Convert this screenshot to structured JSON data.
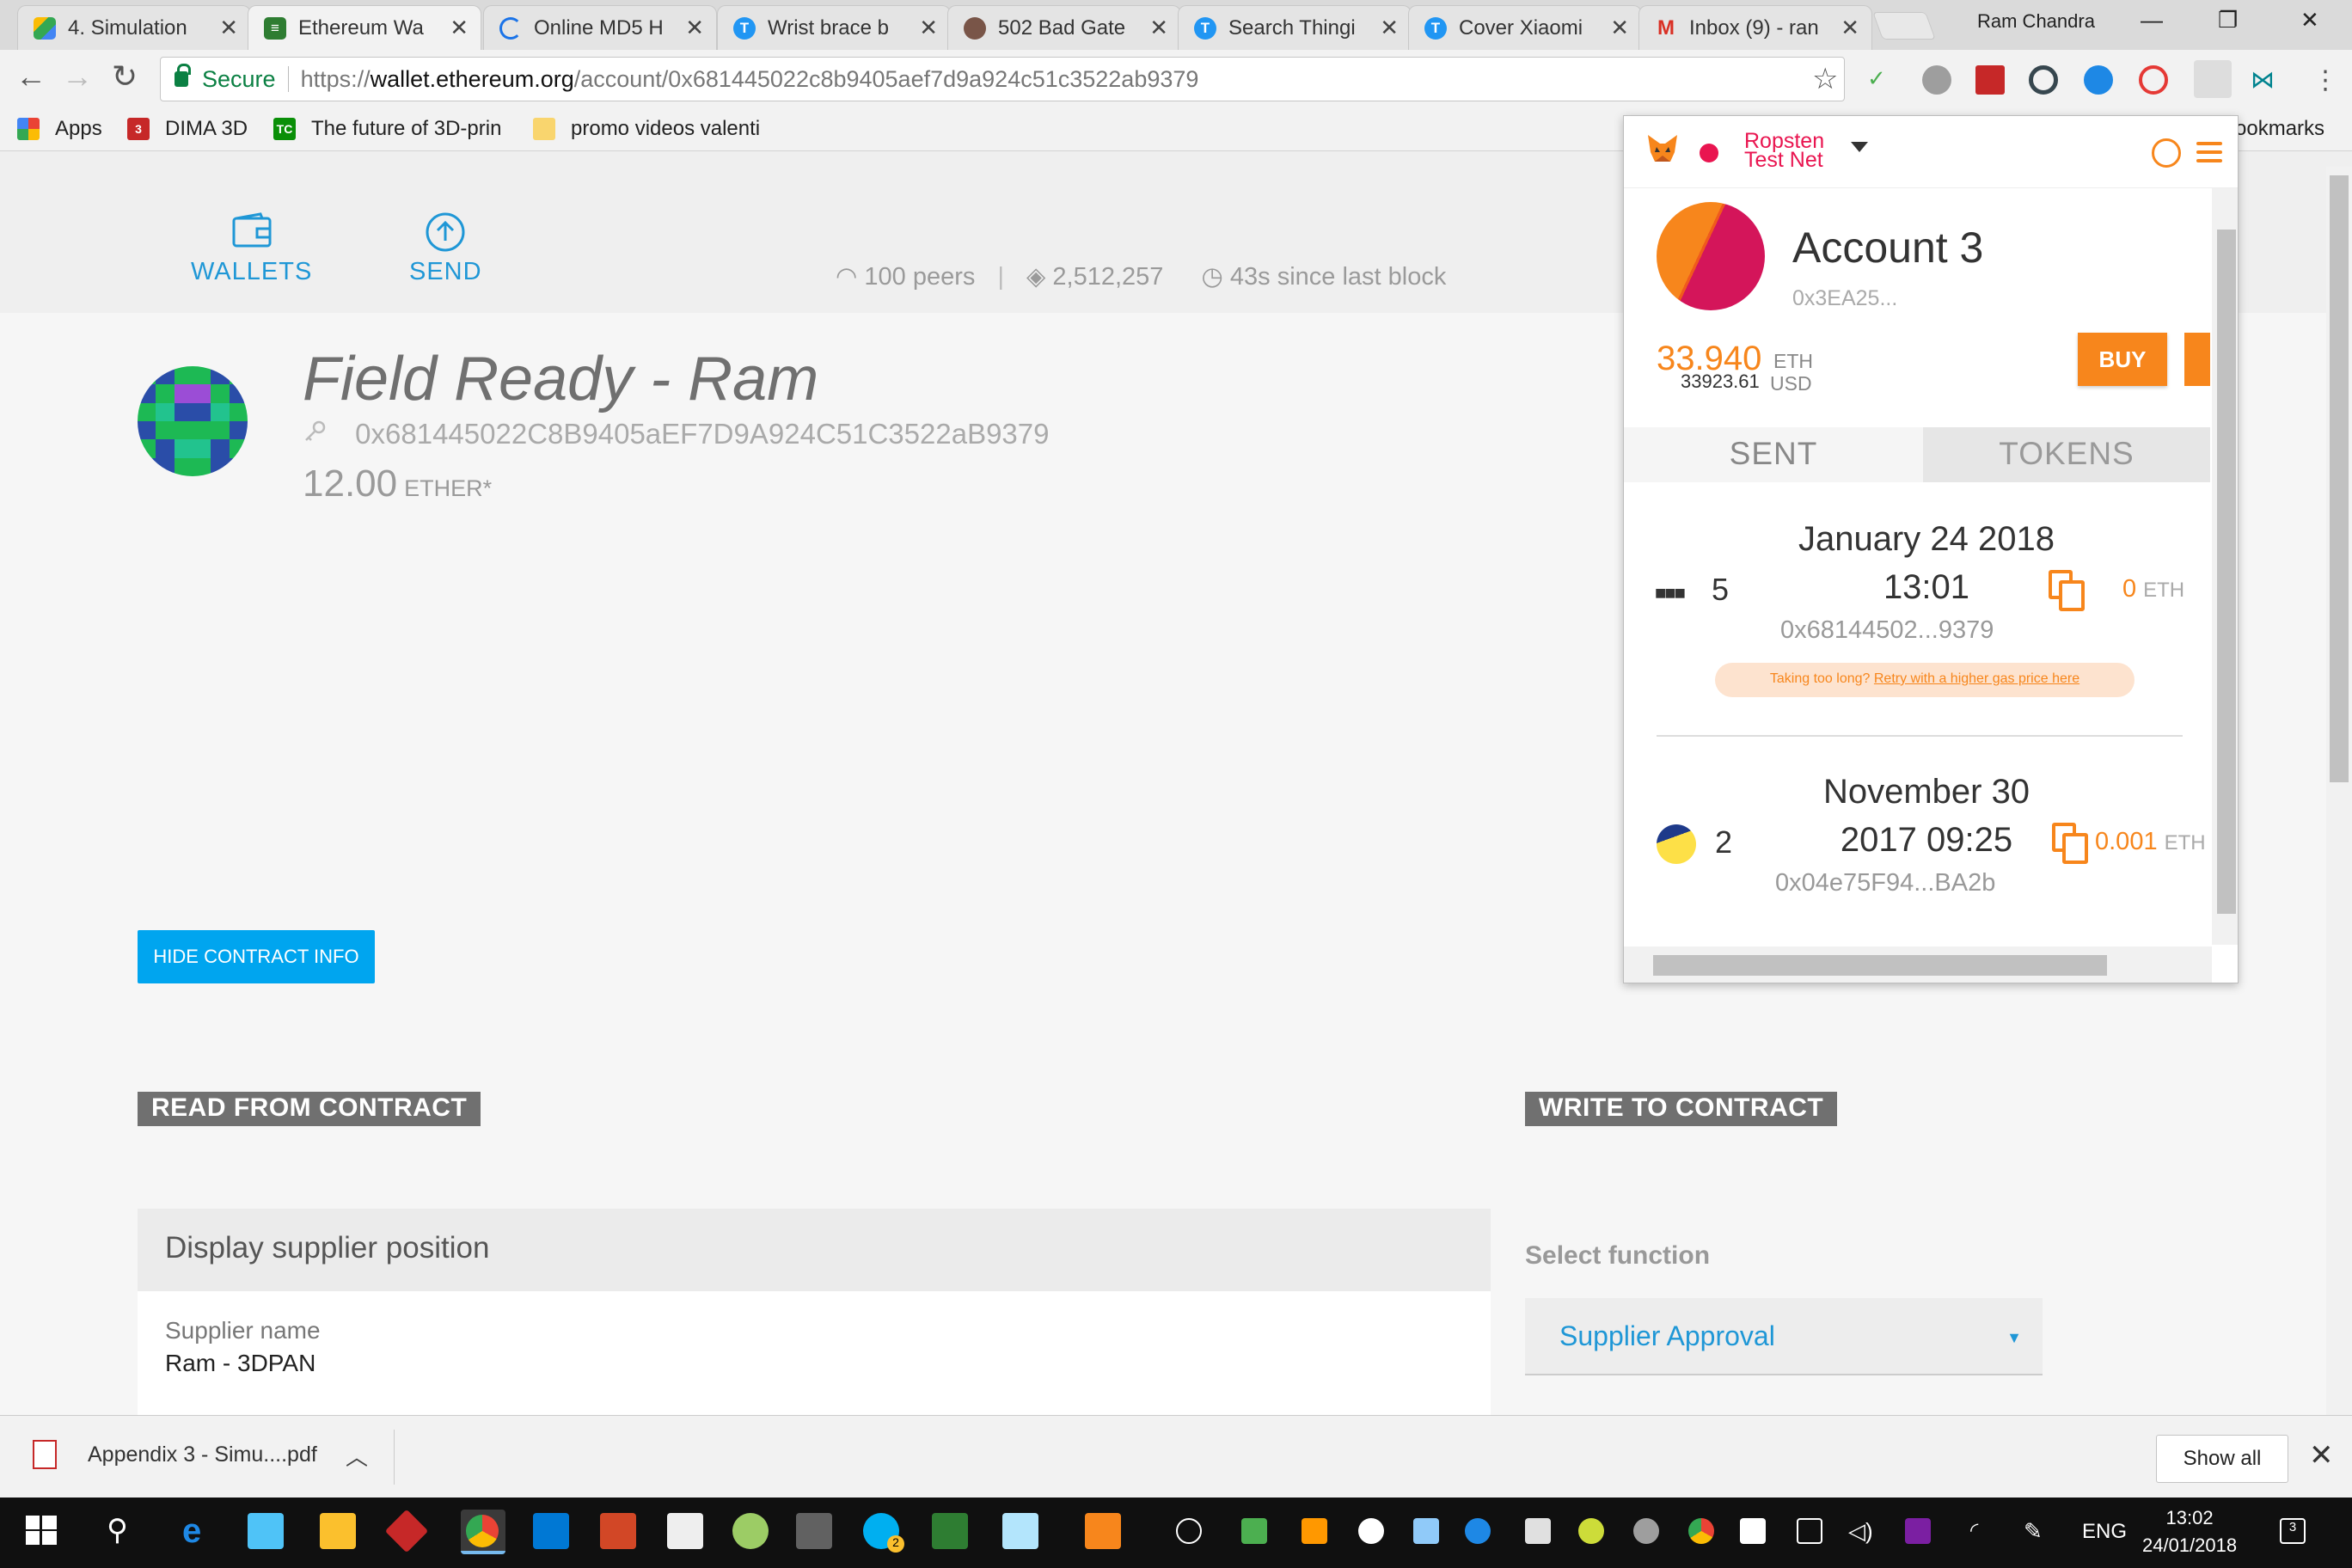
{
  "browser": {
    "tabs": [
      {
        "title": "4. Simulation",
        "icon": "google-drive-icon",
        "color": "#4c8bf5"
      },
      {
        "title": "Ethereum Wa",
        "icon": "ethereum-wallet-icon",
        "color": "#2e7d32"
      },
      {
        "title": "Online MD5 H",
        "icon": "loading-spinner-icon",
        "color": "#1a73e8"
      },
      {
        "title": "Wrist brace b",
        "icon": "tinkercad-icon",
        "color": "#2196f3"
      },
      {
        "title": "502 Bad Gate",
        "icon": "avatar-icon",
        "color": "#795548"
      },
      {
        "title": "Search Thingi",
        "icon": "tinkercad-icon",
        "color": "#2196f3"
      },
      {
        "title": "Cover Xiaomi",
        "icon": "tinkercad-icon",
        "color": "#2196f3"
      },
      {
        "title": "Inbox (9) - ran",
        "icon": "gmail-icon",
        "color": "#d93025"
      }
    ],
    "profile_name": "Ram Chandra",
    "secure_label": "Secure",
    "url_scheme": "https://",
    "url_domain": "wallet.ethereum.org",
    "url_path": "/account/0x681445022c8b9405aef7d9a924c51c3522ab9379",
    "bookmarks": [
      {
        "label": "Apps",
        "icon": "apps-grid-icon"
      },
      {
        "label": "DIMA 3D",
        "icon": "dima3d-icon"
      },
      {
        "label": "The future of 3D-prin",
        "icon": "techcrunch-icon"
      },
      {
        "label": "promo videos valenti",
        "icon": "folder-icon"
      }
    ],
    "bookmarks_overflow": "ookmarks"
  },
  "wallet_page": {
    "nav": [
      {
        "label": "WALLETS",
        "icon": "wallet-icon"
      },
      {
        "label": "SEND",
        "icon": "send-arrow-icon"
      }
    ],
    "peers": "100 peers",
    "block_number": "2,512,257",
    "since_last_block": "43s since last block",
    "wallet_name": "Field Ready - Ram",
    "wallet_address": "0x681445022C8B9405aEF7D9A924C51C3522aB9379",
    "balance": "12.00",
    "balance_unit": "ETHER*",
    "hide_contract_label": "HIDE CONTRACT INFO",
    "read_section": "READ FROM CONTRACT",
    "write_section": "WRITE TO CONTRACT",
    "read_card": {
      "title": "Display supplier position",
      "field_label": "Supplier name",
      "field_value": "Ram - 3DPAN"
    },
    "select_function_label": "Select function",
    "selected_function": "Supplier Approval",
    "identicon_colors": [
      "#1db954",
      "#2a4da8",
      "#9b4dd6",
      "#22c38e"
    ]
  },
  "metamask": {
    "network": [
      "Ropsten",
      "Test Net"
    ],
    "account_name": "Account 3",
    "account_address": "0x3EA25...",
    "eth_balance": "33.940",
    "eth_unit": "ETH",
    "usd_balance": "33923.61",
    "usd_unit": "USD",
    "buy_label": "BUY",
    "tabs": [
      "SENT",
      "TOKENS"
    ],
    "transactions": [
      {
        "date": "January 24 2018",
        "time": "13:01",
        "nonce": "5",
        "address": "0x68144502...9379",
        "value": "0",
        "unit": "ETH",
        "status_icon": "pending-dots-icon"
      },
      {
        "date": "November 30",
        "time": "2017 09:25",
        "nonce": "2",
        "address": "0x04e75F94...BA2b",
        "value": "0.001",
        "unit": "ETH",
        "status_icon": "identicon-icon"
      }
    ],
    "retry_text": "Taking too long? ",
    "retry_link": "Retry with a higher gas price here",
    "accent_color": "#f7861c",
    "network_color": "#e91550"
  },
  "downloads": {
    "file_name": "Appendix 3 - Simu....pdf",
    "show_all_label": "Show all"
  },
  "taskbar": {
    "language": "ENG",
    "time": "13:02",
    "date": "24/01/2018",
    "notification_count": "3",
    "skype_badge": "2"
  }
}
